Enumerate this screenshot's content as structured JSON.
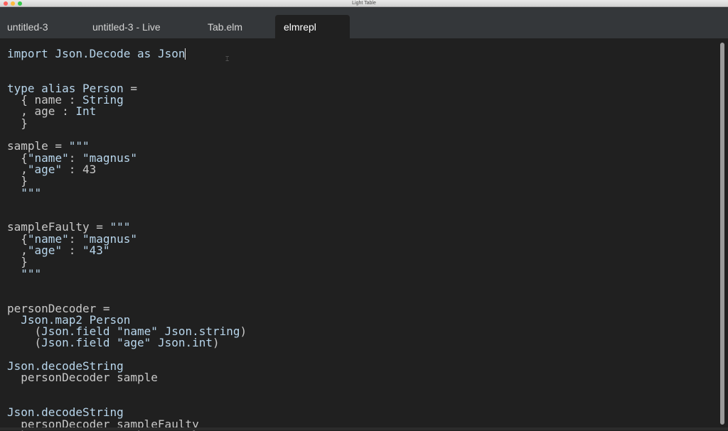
{
  "window": {
    "title": "Light Table"
  },
  "tabs": [
    {
      "label": "untitled-3"
    },
    {
      "label": "untitled-3 - Live"
    },
    {
      "label": "Tab.elm"
    },
    {
      "label": "elmrepl"
    }
  ],
  "editor": {
    "cursor_icon": "text-cursor-icon",
    "lines": [
      "import Json.Decode as Json",
      "",
      "",
      "type alias Person =",
      "  { name : String",
      "  , age : Int",
      "  }",
      "",
      "sample = \"\"\"",
      "  {\"name\": \"magnus\"",
      "  ,\"age\" : 43",
      "  }",
      "  \"\"\"",
      "",
      "",
      "sampleFaulty = \"\"\"",
      "  {\"name\": \"magnus\"",
      "  ,\"age\" : \"43\"",
      "  }",
      "  \"\"\"",
      "",
      "",
      "personDecoder =",
      "  Json.map2 Person",
      "    (Json.field \"name\" Json.string)",
      "    (Json.field \"age\" Json.int)",
      "",
      "Json.decodeString",
      "  personDecoder sample",
      "",
      "",
      "Json.decodeString",
      "  personDecoder sampleFaulty"
    ]
  }
}
